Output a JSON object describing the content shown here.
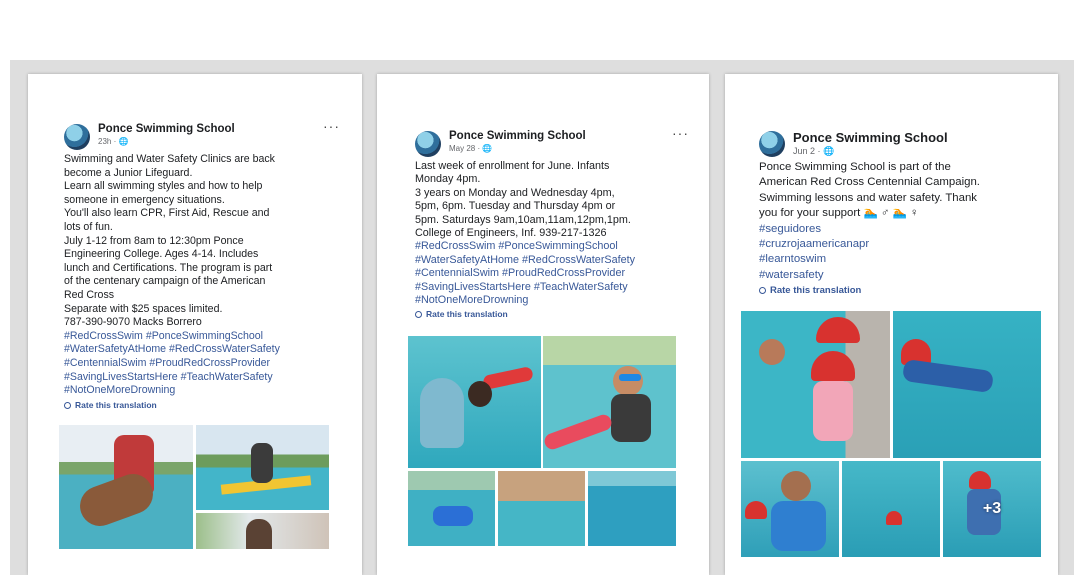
{
  "cards": [
    {
      "name": "Ponce Swimming School",
      "meta": "23h · ",
      "more": "···",
      "lines": [
        "Swimming and Water Safety Clinics are back",
        "become a Junior Lifeguard.",
        "Learn all swimming styles and how to help",
        "someone in emergency situations.",
        "You'll also learn CPR, First Aid, Rescue and",
        "lots of fun.",
        "July 1-12 from 8am to 12:30pm Ponce",
        "Engineering College. Ages 4-14. Includes",
        "lunch and Certifications. The program is part",
        "of the centenary campaign of the American",
        "Red Cross",
        "Separate with $25 spaces limited.",
        "787-390-9070 Macks Borrero"
      ],
      "tags": [
        " #RedCrossSwim #PonceSwimmingSchool",
        "#WaterSafetyAtHome #RedCrossWaterSafety",
        "#CentennialSwim #ProudRedCrossProvider",
        "#SavingLivesStartsHere #TeachWaterSafety",
        "#NotOneMoreDrowning"
      ],
      "rate": "Rate this translation"
    },
    {
      "name": "Ponce Swimming School",
      "meta": "May 28 · ",
      "more": "···",
      "lines": [
        "Last week of enrollment for June. Infants",
        "Monday 4pm.",
        "3 years on Monday and Wednesday 4pm,",
        "5pm, 6pm. Tuesday and Thursday 4pm or",
        "5pm. Saturdays 9am,10am,11am,12pm,1pm.",
        "College of Engineers, Inf. 939-217-1326"
      ],
      "tags": [
        " #RedCrossSwim #PonceSwimmingSchool",
        "#WaterSafetyAtHome #RedCrossWaterSafety",
        "#CentennialSwim #ProudRedCrossProvider",
        "#SavingLivesStartsHere #TeachWaterSafety",
        "#NotOneMoreDrowning"
      ],
      "rate": "Rate this translation"
    },
    {
      "name": "Ponce Swimming School",
      "meta": "Jun 2 · ",
      "lines": [
        "Ponce Swimming School is part of the",
        "American Red Cross Centennial Campaign.",
        "Swimming lessons and water safety. Thank",
        "you for your support 🏊 ♂ 🏊 ♀"
      ],
      "tags": [
        "#seguidores",
        "#cruzrojaamericanapr",
        "#learntoswim",
        "#watersafety"
      ],
      "rate": "Rate this translation",
      "more_photos": "+3"
    }
  ],
  "colors": {
    "hashtag": "#385898",
    "band": "#dedede",
    "pool": "#3ab5c8"
  },
  "icons": [
    "globe-icon",
    "more-options-icon",
    "translate-icon"
  ]
}
